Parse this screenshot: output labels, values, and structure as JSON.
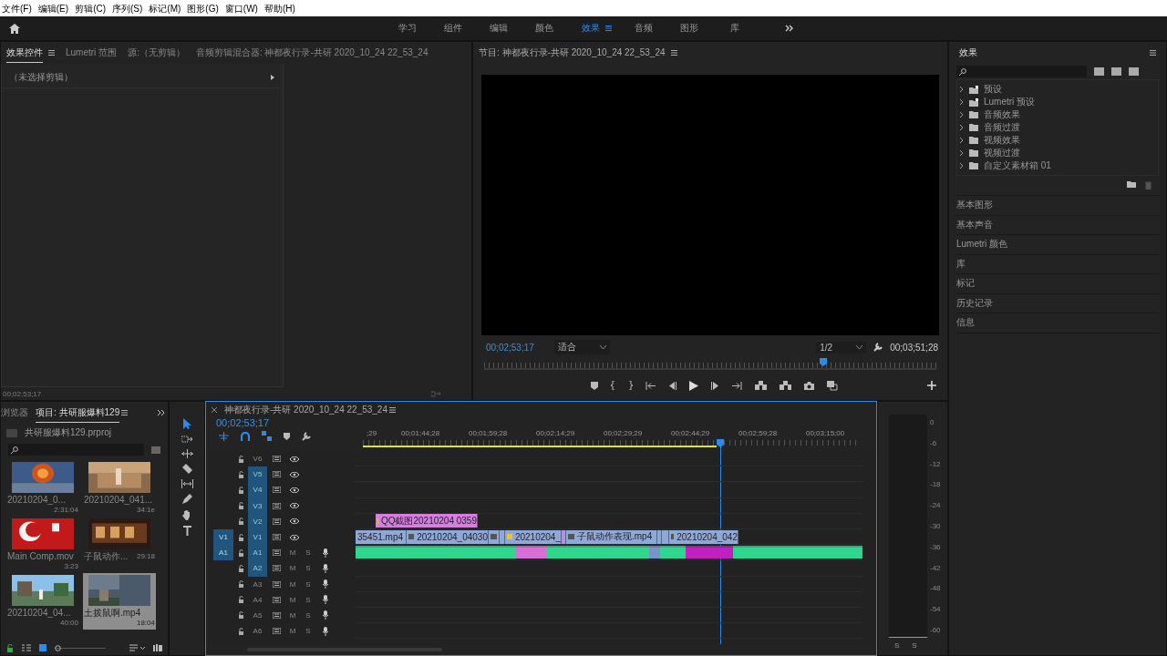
{
  "menu": [
    "文件(F)",
    "编辑(E)",
    "剪辑(C)",
    "序列(S)",
    "标记(M)",
    "图形(G)",
    "窗口(W)",
    "帮助(H)"
  ],
  "workspaces": [
    {
      "label": "学习",
      "selected": false
    },
    {
      "label": "组件",
      "selected": false
    },
    {
      "label": "编辑",
      "selected": false
    },
    {
      "label": "颜色",
      "selected": false
    },
    {
      "label": "效果",
      "selected": true
    },
    {
      "label": "音频",
      "selected": false
    },
    {
      "label": "图形",
      "selected": false
    },
    {
      "label": "库",
      "selected": false
    }
  ],
  "effect_controls": {
    "tabs": [
      {
        "label": "效果控件",
        "selected": true
      },
      {
        "label": "Lumetri 范围",
        "selected": false
      },
      {
        "label": "源:（无剪辑）",
        "selected": false
      },
      {
        "label": "音频剪辑混合器: 神都夜行录-共研 2020_10_24 22_53_24",
        "selected": false
      }
    ],
    "message": "（未选择剪辑）",
    "timecode": "00;02;53;17"
  },
  "program": {
    "title": "节目: 神都夜行录-共研 2020_10_24 22_53_24",
    "timecode": "00;02;53;17",
    "zoom": "适合",
    "resolution": "1/2",
    "duration": "00;03;51;28",
    "playhead": {
      "level": 0.75
    }
  },
  "project": {
    "tabs": [
      {
        "label": "浏览器",
        "selected": false
      },
      {
        "label": "项目: 共研服爆料129",
        "selected": true
      }
    ],
    "file": "共研服爆料129.prproj",
    "zoom": {
      "level": 0.05
    },
    "items": [
      {
        "name": "20210204_0...",
        "duration": "2:31:04",
        "selected": false
      },
      {
        "name": "20210204_041...",
        "duration": "34:1e",
        "selected": false
      },
      {
        "name": "Main Comp.mov",
        "duration": "3:23",
        "selected": false
      },
      {
        "name": "子鼠动作...",
        "duration": "29:18",
        "selected": false
      },
      {
        "name": "20210204_04...",
        "duration": "40:00",
        "selected": false
      },
      {
        "name": "土拨鼠啊.mp4",
        "duration": "18:04",
        "selected": true
      }
    ]
  },
  "timeline": {
    "title": "神都夜行录-共研 2020_10_24 22_53_24",
    "timecode": "00;02;53;17",
    "ruler": [
      ";29",
      "00;01;44;28",
      "00;01;59;28",
      "00;02;14;29",
      "00;02;29;29",
      "00;02;44;29",
      "00;02;59;28",
      "00;03;15;00"
    ],
    "playhead": {
      "level": 0.72
    },
    "work_area": {
      "level": 0.71
    },
    "tracks": [
      {
        "kind": "video",
        "name": "V6",
        "targeted": false
      },
      {
        "kind": "video",
        "name": "V5",
        "targeted": true
      },
      {
        "kind": "video",
        "name": "V4",
        "targeted": true
      },
      {
        "kind": "video",
        "name": "V3",
        "targeted": true
      },
      {
        "kind": "video",
        "name": "V2",
        "targeted": true,
        "clips": [
          {
            "label": "QQ截图20210204 0359",
            "color": "#d77fdc",
            "kind": "effect"
          }
        ]
      },
      {
        "kind": "video",
        "name": "V1",
        "targeted": true,
        "source": "V1",
        "clips": [
          {
            "label": "35451.mp4",
            "color": "#8fa9d4"
          },
          {
            "label": "20210204_04030",
            "color": "#8fa9d4",
            "kind": "media"
          },
          {
            "color": "#8fa9d4",
            "kind": "media"
          },
          {
            "color": "#8fa9d4"
          },
          {
            "label": "20210204_",
            "color": "#8fa9d4",
            "kind": "effect"
          },
          {
            "color": "#b592dd"
          },
          {
            "label": "子鼠动作表现.mp4",
            "color": "#8fa9d4",
            "kind": "media"
          },
          {
            "color": "#8fa9d4"
          },
          {
            "color": "#8fa9d4"
          },
          {
            "label": "20210204_042",
            "color": "#8fa9d4",
            "kind": "media"
          }
        ]
      },
      {
        "kind": "audio",
        "name": "A1",
        "targeted": true,
        "source": "A1",
        "mute": "M",
        "solo": "S",
        "clips": [
          {
            "color": "#2fd68d"
          },
          {
            "color": "#d86fd6"
          },
          {
            "color": "#2fd68d"
          },
          {
            "color": "#7b93c8"
          },
          {
            "color": "#2fd68d"
          },
          {
            "color": "#c21fc0"
          },
          {
            "color": "#2fd68d"
          }
        ]
      },
      {
        "kind": "audio",
        "name": "A2",
        "targeted": true,
        "mute": "M",
        "solo": "S"
      },
      {
        "kind": "audio",
        "name": "A3",
        "targeted": false,
        "mute": "M",
        "solo": "S"
      },
      {
        "kind": "audio",
        "name": "A4",
        "targeted": false,
        "mute": "M",
        "solo": "S"
      },
      {
        "kind": "audio",
        "name": "A5",
        "targeted": false,
        "mute": "M",
        "solo": "S"
      },
      {
        "kind": "audio",
        "name": "A6",
        "targeted": false,
        "mute": "M",
        "solo": "S"
      }
    ]
  },
  "meters": {
    "scale": [
      "0",
      "-6",
      "-12",
      "-18",
      "-24",
      "-30",
      "-36",
      "-42",
      "-48",
      "-54",
      "-60"
    ],
    "solo": [
      "S",
      "S"
    ]
  },
  "effects": {
    "title": "效果",
    "tree": [
      {
        "kind": "preset",
        "label": "预设"
      },
      {
        "kind": "preset",
        "label": "Lumetri 预设"
      },
      {
        "kind": "folder",
        "label": "音频效果"
      },
      {
        "kind": "folder",
        "label": "音频过渡"
      },
      {
        "kind": "folder",
        "label": "视频效果"
      },
      {
        "kind": "folder",
        "label": "视频过渡"
      },
      {
        "kind": "folder",
        "label": "自定义素材箱 01"
      }
    ],
    "panels": [
      "基本图形",
      "基本声音",
      "Lumetri 颜色",
      "库",
      "标记",
      "历史记录",
      "信息"
    ]
  }
}
